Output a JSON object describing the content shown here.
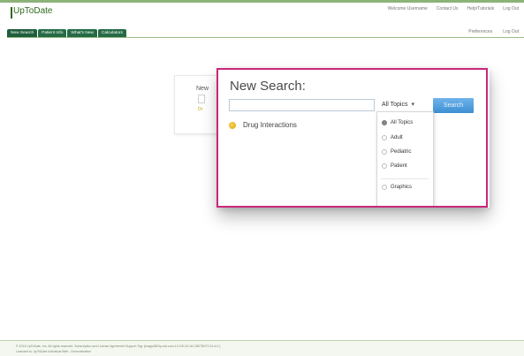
{
  "header": {
    "logo_text": "UpToDate",
    "links": [
      "Welcome Username",
      "Contact Us",
      "Help/Tutorials",
      "Log Out"
    ],
    "links2": [
      "Preferences",
      "Log Out"
    ]
  },
  "nav": {
    "tabs": [
      "New Search",
      "Patient Info",
      "What's New",
      "Calculators"
    ]
  },
  "background": {
    "title_fragment": "New",
    "drug_fragment": "Dr"
  },
  "zoom": {
    "title": "New Search:",
    "search_value": "",
    "select_value": "All Topics",
    "search_button": "Search",
    "drug_link": "Drug Interactions",
    "dropdown_items": [
      {
        "label": "All Topics",
        "checked": true
      },
      {
        "label": "Adult",
        "checked": false
      },
      {
        "label": "Pediatric",
        "checked": false
      },
      {
        "label": "Patient",
        "checked": false
      },
      {
        "label": "Graphics",
        "checked": false
      }
    ]
  },
  "footer": {
    "line1": "© 2013 UpToDate, Inc. All rights reserved.   Subscription and License Agreement   Support Tag: [ecapp0601p.utd.com-10.100.10.16-CB07BD7C14-6.0 ]",
    "line2": "Licensed to: UpToDate Individual Web - Demonstration"
  },
  "colors": {
    "accent_border": "#c8287a",
    "nav_green": "#246b45",
    "search_button": "#3d8fd2"
  }
}
